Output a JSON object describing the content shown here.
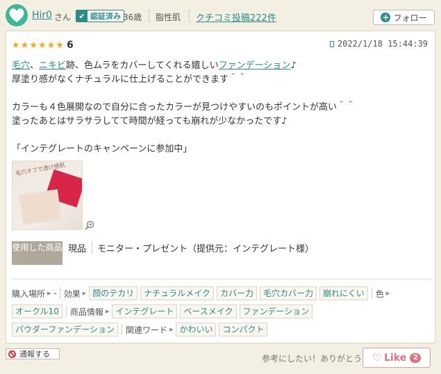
{
  "header": {
    "avatar_text": "Hir0",
    "username": "Hir0",
    "honorific": "さん",
    "verified_label": "認証済み",
    "age": "36歳",
    "skin_type": "脂性肌",
    "posts_label": "クチコミ投稿222件",
    "follow_label": "フォロー"
  },
  "review": {
    "stars_filled": 6,
    "stars_total": 6,
    "score": "6",
    "date": "2022/1/18 15:44:39",
    "body": {
      "line1_link1": "毛穴",
      "line1_sep": "、",
      "line1_link2": "ニキビ",
      "line1_mid": "跡、色ムラをカバーしてくれる嬉しい",
      "line1_link3": "ファンデーション",
      "line1_end": "♪",
      "line2": "厚塗り感がなくナチュラルに仕上げることができます＾＾",
      "line3": "カラーも４色展開なので自分に合ったカラーが見つけやすいのもポイントが高い＾＾",
      "line4": "塗ったあとはサラサラしてて時間が経っても崩れが少なかったです♪",
      "line5": "「インテグレートのキャンペーンに参加中」"
    },
    "photo_text": "毛穴オフで透け感肌",
    "used_badge": "使用した商品",
    "product_type": "現品",
    "monitor": "モニター・プレゼント（提供元：インテグレート様）"
  },
  "tags": {
    "purchase_label": "購入場所",
    "purchase_value": "-",
    "effect_label": "効果",
    "effects": [
      "顔のテカリ",
      "ナチュラルメイク",
      "カバー力",
      "毛穴カバー力",
      "崩れにくい"
    ],
    "color_label": "色",
    "colors": [
      "オークル10"
    ],
    "product_info_label": "商品情報",
    "product_info": [
      "インテグレート",
      "ベースメイク",
      "ファンデーション",
      "パウダーファンデーション"
    ],
    "related_label": "関連ワード",
    "related": [
      "かわいい",
      "コンパクト"
    ]
  },
  "footer": {
    "report_label": "通報する",
    "thanks_text": "参考にしたい！ありがとう",
    "like_label": "Like",
    "like_count": "2"
  },
  "colors": {
    "accent": "#2c8a8a",
    "star": "#f5a623",
    "like": "#e07088"
  }
}
